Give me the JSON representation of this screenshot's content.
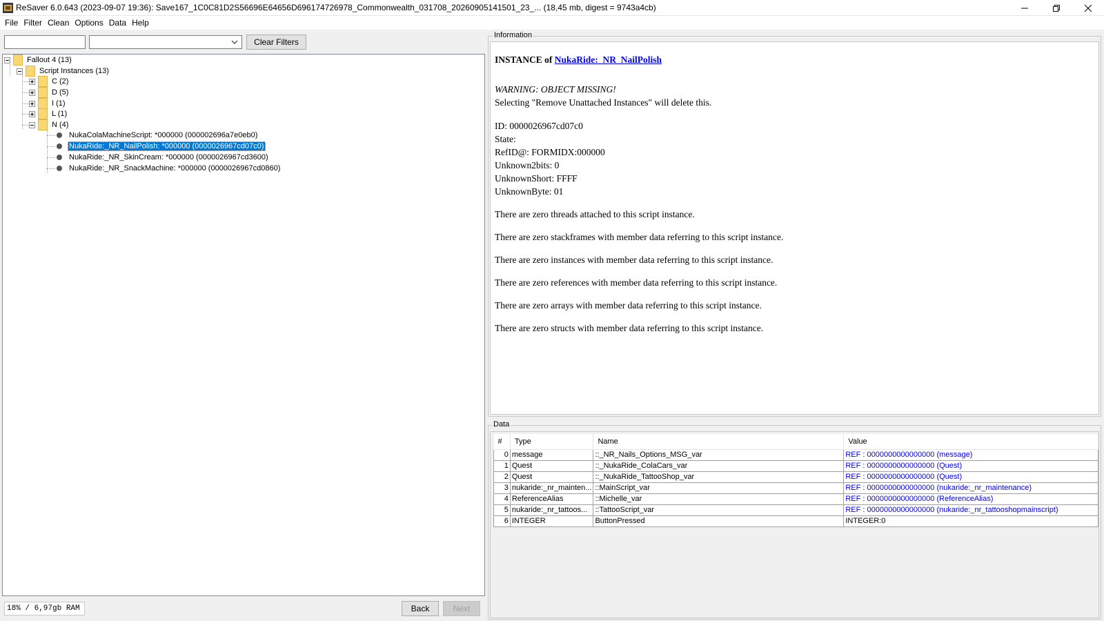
{
  "window": {
    "title": "ReSaver 6.0.643 (2023-09-07 19:36): Save167_1C0C81D2S56696E64656D696174726978_Commonwealth_031708_20260905141501_23_... (18,45 mb, digest = 9743a4cb)",
    "icon": "resaver-app-icon"
  },
  "menu": [
    "File",
    "Filter",
    "Clean",
    "Options",
    "Data",
    "Help"
  ],
  "filter": {
    "text_value": "",
    "combo_value": "",
    "clear_label": "Clear Filters"
  },
  "tree": {
    "root": "Fallout 4 (13)",
    "script_instances": "Script Instances (13)",
    "groups": [
      "C (2)",
      "D (5)",
      "I (1)",
      "L (1)",
      "N (4)"
    ],
    "n_children": [
      "NukaColaMachineScript: *000000 (000002696a7e0eb0)",
      "NukaRide:_NR_NailPolish: *000000 (0000026967cd07c0)",
      "NukaRide:_NR_SkinCream: *000000 (0000026967cd3600)",
      "NukaRide:_NR_SnackMachine: *000000 (0000026967cd0860)"
    ],
    "selected_index": 1
  },
  "status": {
    "ram": "18% / 6,97gb RAM",
    "back_label": "Back",
    "next_label": "Next"
  },
  "info": {
    "group_title": "Information",
    "heading_prefix": "INSTANCE of ",
    "heading_link": "NukaRide:_NR_NailPolish",
    "warning": "WARNING: OBJECT MISSING!",
    "warning_detail": "Selecting \"Remove Unattached Instances\" will delete this.",
    "fields": [
      "ID: 0000026967cd07c0",
      "State:",
      "RefID@: FORMIDX:000000",
      "Unknown2bits: 0",
      "UnknownShort: FFFF",
      "UnknownByte: 01"
    ],
    "notes": [
      "There are zero threads attached to this script instance.",
      "There are zero stackframes with member data referring to this script instance.",
      "There are zero instances with member data referring to this script instance.",
      "There are zero references with member data referring to this script instance.",
      "There are zero arrays with member data referring to this script instance.",
      "There are zero structs with member data referring to this script instance."
    ]
  },
  "data": {
    "group_title": "Data",
    "columns": [
      "#",
      "Type",
      "Name",
      "Value"
    ],
    "rows": [
      {
        "num": "0",
        "type": "message",
        "name": "::_NR_Nails_Options_MSG_var",
        "value": "REF : 0000000000000000 (message)",
        "is_ref": true
      },
      {
        "num": "1",
        "type": "Quest",
        "name": "::_NukaRide_ColaCars_var",
        "value": "REF : 0000000000000000 (Quest)",
        "is_ref": true
      },
      {
        "num": "2",
        "type": "Quest",
        "name": "::_NukaRide_TattooShop_var",
        "value": "REF : 0000000000000000 (Quest)",
        "is_ref": true
      },
      {
        "num": "3",
        "type": "nukaride:_nr_mainten...",
        "name": "::MainScript_var",
        "value": "REF : 0000000000000000 (nukaride:_nr_maintenance)",
        "is_ref": true
      },
      {
        "num": "4",
        "type": "ReferenceAlias",
        "name": "::Michelle_var",
        "value": "REF : 0000000000000000 (ReferenceAlias)",
        "is_ref": true
      },
      {
        "num": "5",
        "type": "nukaride:_nr_tattoos...",
        "name": "::TattooScript_var",
        "value": "REF : 0000000000000000 (nukaride:_nr_tattooshopmainscript)",
        "is_ref": true
      },
      {
        "num": "6",
        "type": "INTEGER",
        "name": "ButtonPressed",
        "value": "INTEGER:0",
        "is_ref": false
      }
    ]
  },
  "colors": {
    "selection": "#0078d7",
    "link": "#0000ee",
    "folder": "#f8d775"
  }
}
